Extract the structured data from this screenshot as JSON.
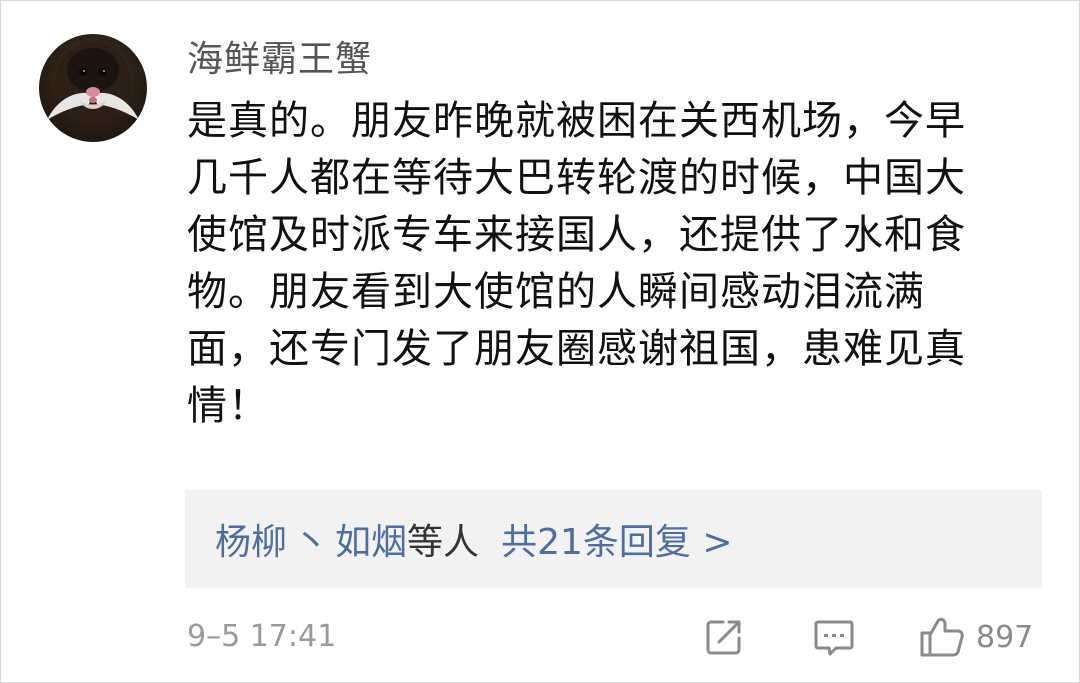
{
  "comment": {
    "username": "海鲜霸王蟹",
    "lines": [
      "是真的。朋友昨晚就被困在关西机场，今早",
      "几千人都在等待大巴转轮渡的时候，中国大",
      "使馆及时派专车来接国人，还提供了水和食",
      "物。朋友看到大使馆的人瞬间感动泪流满",
      "面，还专门发了朋友圈感谢祖国，患难见真",
      "情！"
    ],
    "timestamp": "9–5 17:41"
  },
  "replies": {
    "names": [
      "杨柳",
      "如烟"
    ],
    "separator": "丶",
    "suffix": "等人",
    "count_label": "共21条回复 >"
  },
  "actions": {
    "share_icon": "share-icon",
    "comment_icon": "comment-icon",
    "like_icon": "thumbs-up-icon",
    "like_count": "897"
  },
  "colors": {
    "link": "#4a6fa0",
    "muted": "#9a9a9a",
    "text": "#111111",
    "reply_bg": "#f2f2f2"
  }
}
